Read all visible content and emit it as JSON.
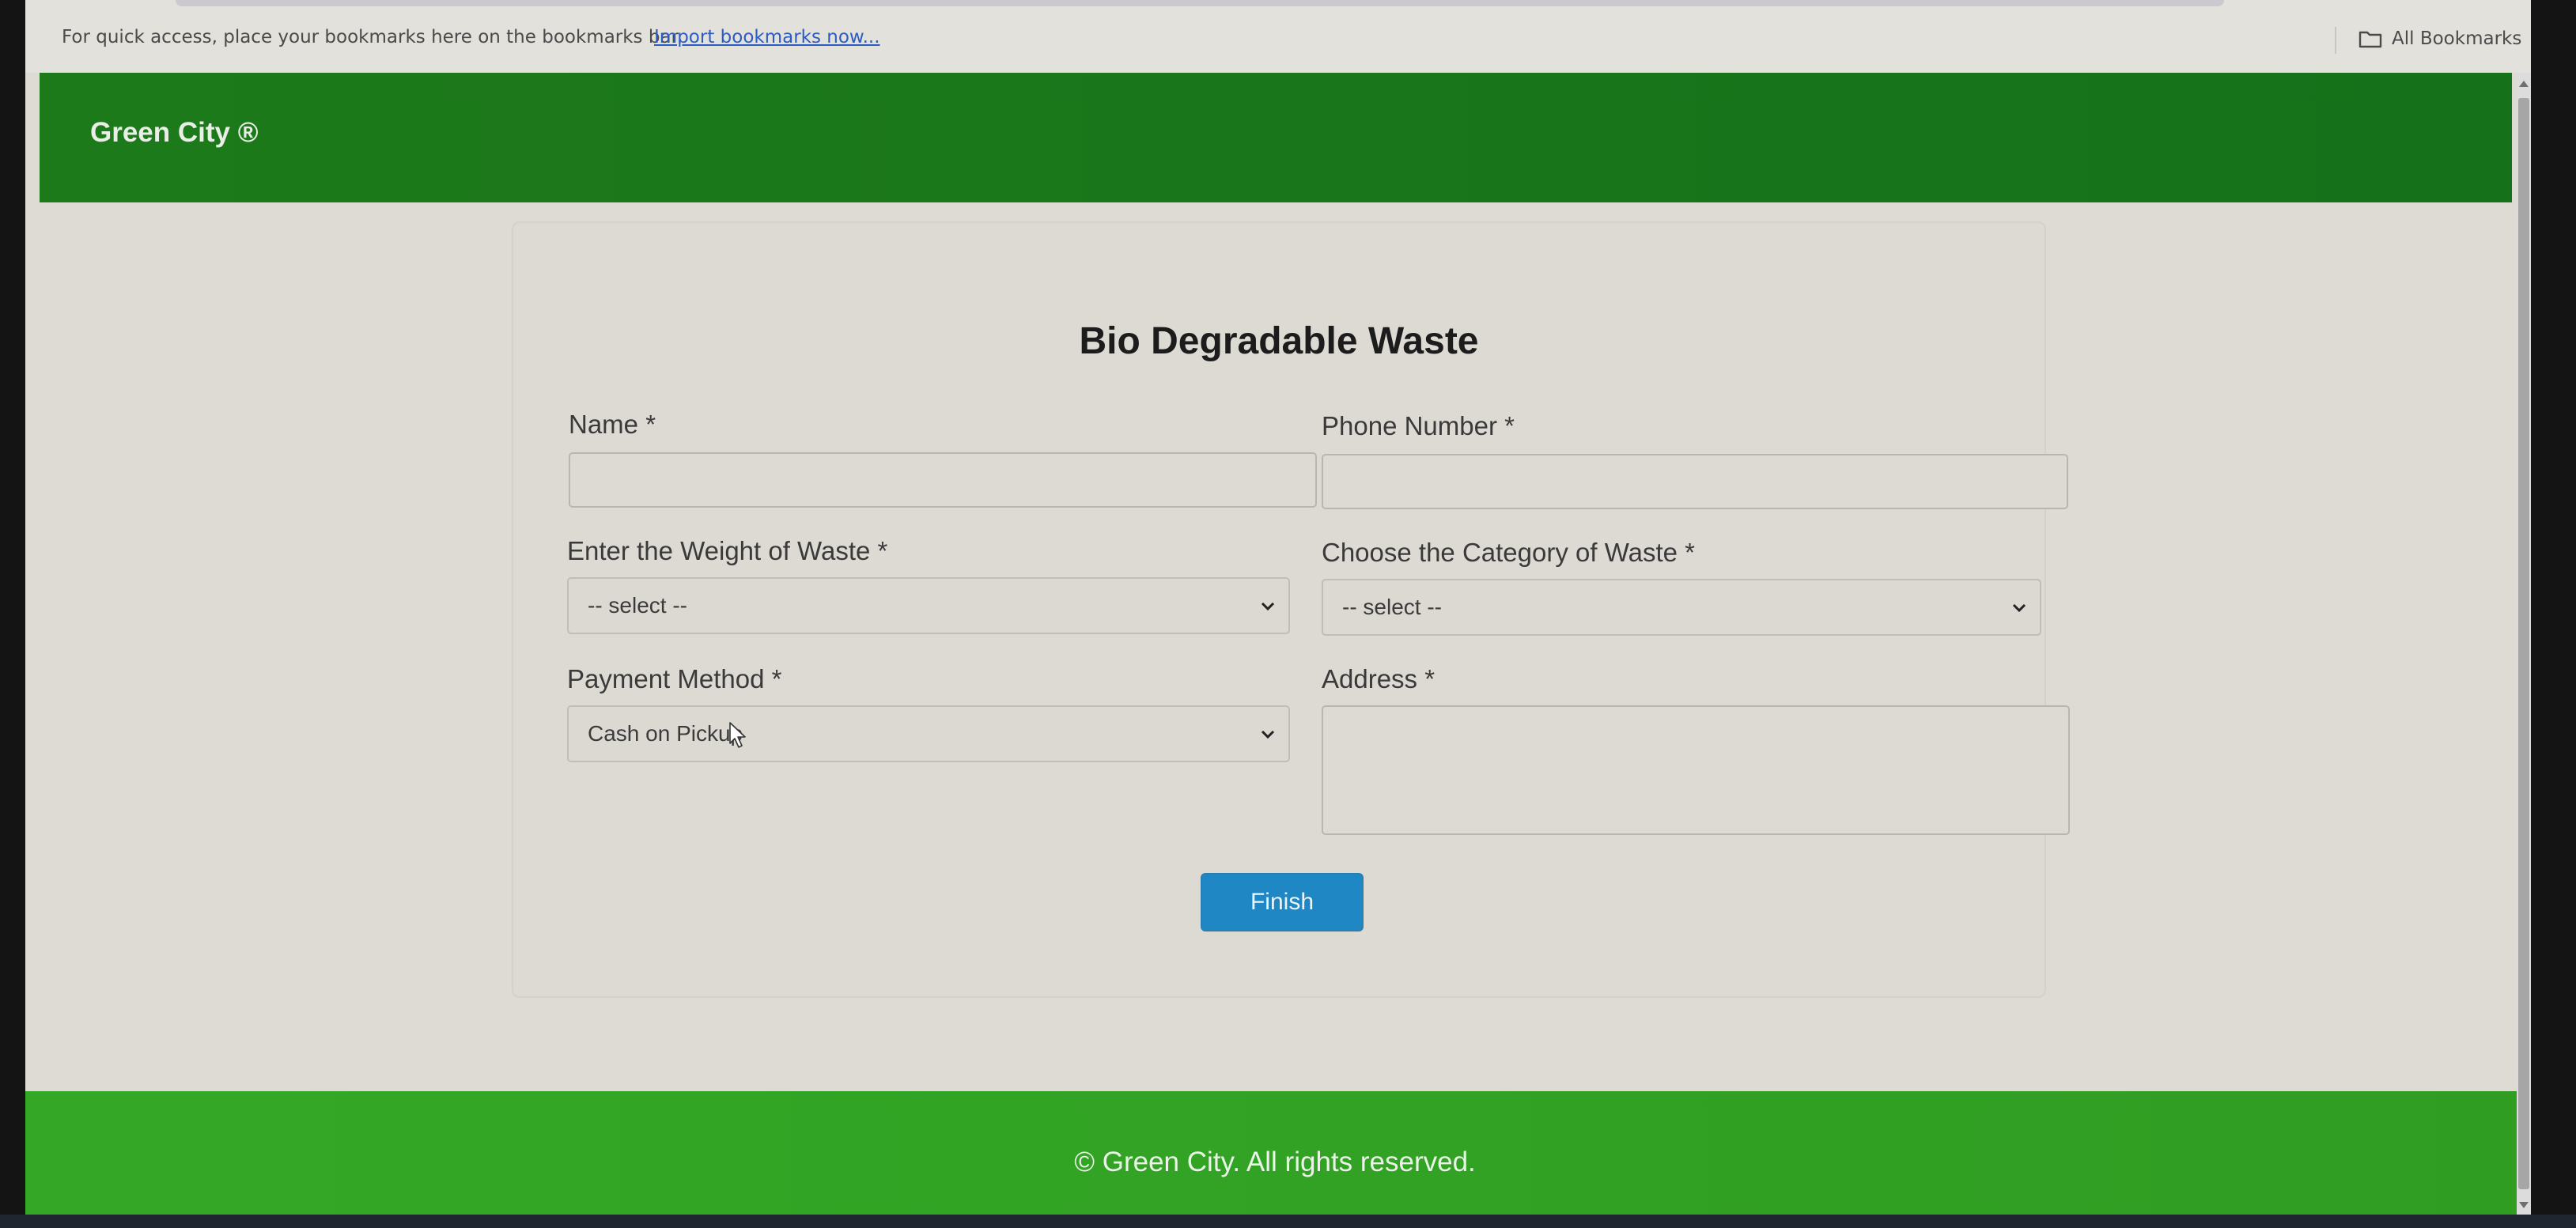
{
  "browser": {
    "bookmarks_hint": "For quick access, place your bookmarks here on the bookmarks bar.",
    "import_link": "Import bookmarks now...",
    "all_bookmarks": "All Bookmarks"
  },
  "header": {
    "brand": "Green City ®"
  },
  "form": {
    "title": "Bio Degradable Waste",
    "name_label": "Name *",
    "name_value": "",
    "phone_label": "Phone Number *",
    "phone_value": "",
    "weight_label": "Enter the Weight of Waste *",
    "weight_selected": "-- select --",
    "category_label": "Choose the Category of Waste *",
    "category_selected": "-- select --",
    "payment_label": "Payment Method *",
    "payment_selected": "Cash on Pickup",
    "address_label": "Address *",
    "address_value": "",
    "finish_label": "Finish"
  },
  "footer": {
    "copyright": "© Green City. All rights reserved."
  },
  "colors": {
    "header_green": "#1d7a1a",
    "footer_green": "#34a826",
    "button_blue": "#1f88c4",
    "page_bg": "#dedbd4"
  }
}
